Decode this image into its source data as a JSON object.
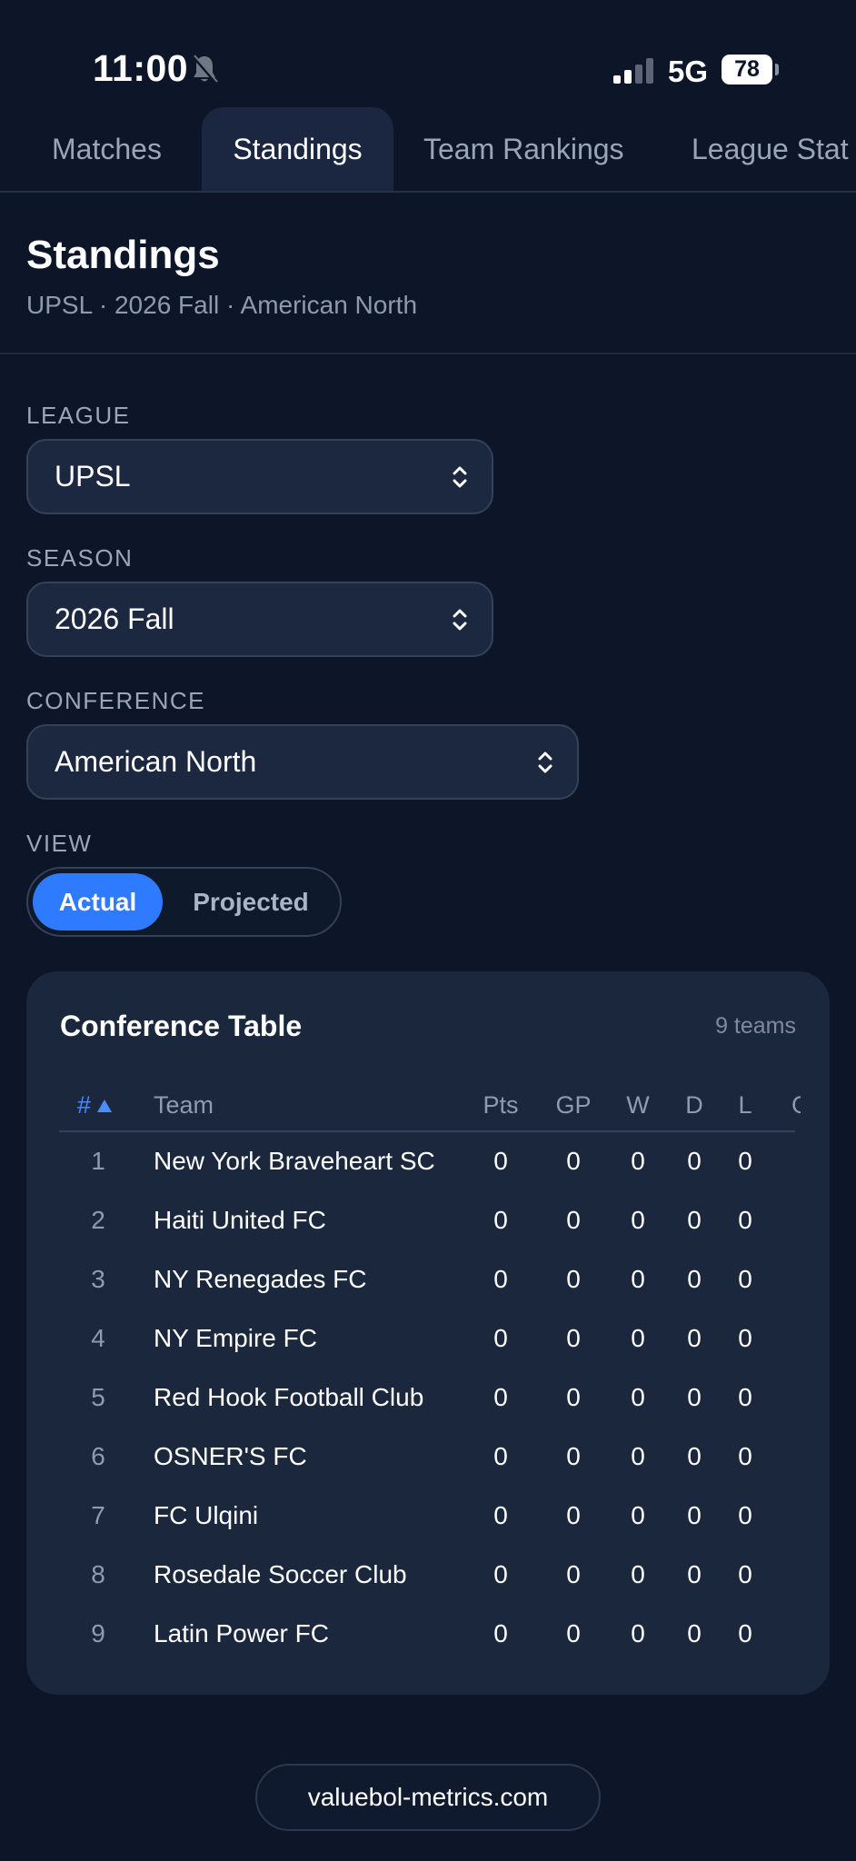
{
  "status_bar": {
    "time": "11:00",
    "network": "5G",
    "battery": "78",
    "icons": [
      "bell-slash-icon",
      "signal-icon",
      "battery-icon"
    ]
  },
  "tabs": [
    {
      "label": "Matches",
      "active": false
    },
    {
      "label": "Standings",
      "active": true
    },
    {
      "label": "Team Rankings",
      "active": false
    },
    {
      "label": "League Stat",
      "active": false
    }
  ],
  "header": {
    "title": "Standings",
    "subtitle": "UPSL · 2026 Fall · American North"
  },
  "filters": {
    "league": {
      "label": "LEAGUE",
      "value": "UPSL"
    },
    "season": {
      "label": "SEASON",
      "value": "2026 Fall"
    },
    "conference": {
      "label": "CONFERENCE",
      "value": "American North"
    },
    "view": {
      "label": "VIEW",
      "options": [
        "Actual",
        "Projected"
      ],
      "selected": "Actual"
    }
  },
  "table_card": {
    "title": "Conference Table",
    "meta": "9 teams",
    "columns": [
      "#",
      "Team",
      "Pts",
      "GP",
      "W",
      "D",
      "L",
      "G"
    ],
    "sort_icon": "sort-asc-icon",
    "rows": [
      {
        "rank": "1",
        "team": "New York Braveheart SC",
        "pts": "0",
        "gp": "0",
        "w": "0",
        "d": "0",
        "l": "0"
      },
      {
        "rank": "2",
        "team": "Haiti United FC",
        "pts": "0",
        "gp": "0",
        "w": "0",
        "d": "0",
        "l": "0"
      },
      {
        "rank": "3",
        "team": "NY Renegades FC",
        "pts": "0",
        "gp": "0",
        "w": "0",
        "d": "0",
        "l": "0"
      },
      {
        "rank": "4",
        "team": "NY Empire FC",
        "pts": "0",
        "gp": "0",
        "w": "0",
        "d": "0",
        "l": "0"
      },
      {
        "rank": "5",
        "team": "Red Hook Football Club",
        "pts": "0",
        "gp": "0",
        "w": "0",
        "d": "0",
        "l": "0"
      },
      {
        "rank": "6",
        "team": "OSNER'S FC",
        "pts": "0",
        "gp": "0",
        "w": "0",
        "d": "0",
        "l": "0"
      },
      {
        "rank": "7",
        "team": "FC Ulqini",
        "pts": "0",
        "gp": "0",
        "w": "0",
        "d": "0",
        "l": "0"
      },
      {
        "rank": "8",
        "team": "Rosedale Soccer Club",
        "pts": "0",
        "gp": "0",
        "w": "0",
        "d": "0",
        "l": "0"
      },
      {
        "rank": "9",
        "team": "Latin Power FC",
        "pts": "0",
        "gp": "0",
        "w": "0",
        "d": "0",
        "l": "0"
      }
    ]
  },
  "footer": {
    "domain": "valuebol-metrics.com"
  },
  "colors": {
    "background": "#0d1628",
    "card": "#1b273d",
    "accent": "#2e7bff",
    "muted_text": "#8f9bb0"
  }
}
